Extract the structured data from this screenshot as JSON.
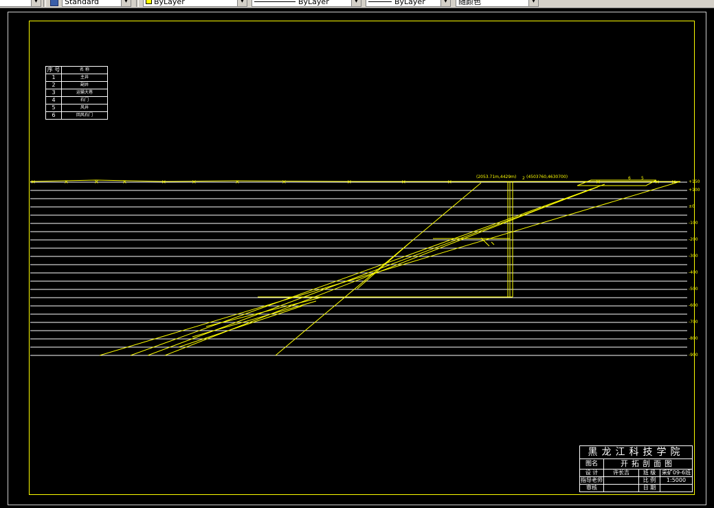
{
  "toolbar": {
    "style_value": "Standard",
    "layer_color_value": "ByLayer",
    "linetype_value": "ByLayer",
    "lineweight_value": "ByLayer",
    "plot_color_value": "随颜色"
  },
  "legend": {
    "header": [
      "序 号",
      "名 称"
    ],
    "rows": [
      {
        "num": "1",
        "name": "主井"
      },
      {
        "num": "2",
        "name": "副井"
      },
      {
        "num": "3",
        "name": "运输大巷"
      },
      {
        "num": "4",
        "name": "石门"
      },
      {
        "num": "5",
        "name": "风井"
      },
      {
        "num": "6",
        "name": "回风石门"
      }
    ]
  },
  "elevations": [
    "+150",
    "+100",
    "±0",
    "-100",
    "-200",
    "-300",
    "-400",
    "-500",
    "-600",
    "-700",
    "-800",
    "-900"
  ],
  "shaft_coords": {
    "left": "(2053.71m,4429m)",
    "right": "(4503760,4630700)"
  },
  "labels": {
    "shaft_2": "2",
    "shaft_5": "5",
    "shaft_6": "6"
  },
  "title_block": {
    "school": "黑龙江科技学院",
    "drawing_name_label": "图名",
    "drawing_name": "开拓剖面图",
    "design_label": "设 计",
    "designer": "许长吉",
    "class_label": "班 级",
    "class_value": "采矿09-6班",
    "advisor_label": "指导老师",
    "advisor": "",
    "scale_label": "比 例",
    "scale_value": "1:5000",
    "review_label": "审核",
    "review": "",
    "date_label": "日 期",
    "date_value": ""
  }
}
